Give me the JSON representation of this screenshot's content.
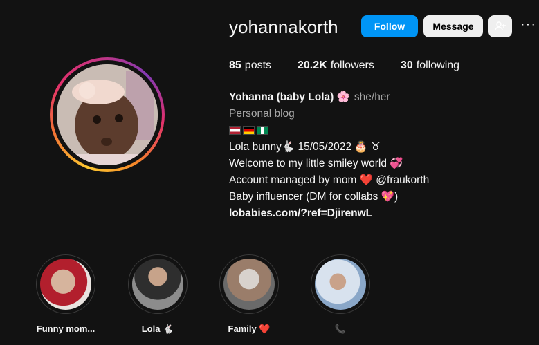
{
  "profile": {
    "username": "yohannakorth",
    "follow_label": "Follow",
    "message_label": "Message",
    "more_icon": "···"
  },
  "stats": {
    "posts_count": "85",
    "posts_label": "posts",
    "followers_count": "20.2K",
    "followers_label": "followers",
    "following_count": "30",
    "following_label": "following"
  },
  "bio": {
    "name": "Yohanna (baby Lola) 🌸",
    "pronouns": "she/her",
    "category": "Personal blog",
    "line1": "Lola bunny🐇 15/05/2022 🎂 ♉",
    "line2": "Welcome to my little smiley world 💞",
    "line3": "Account managed by mom ❤️ @fraukorth",
    "line4": "Baby influencer (DM for collabs 💖)",
    "link": "lobabies.com/?ref=DjirenwL"
  },
  "highlights": [
    {
      "label": "Funny mom...",
      "color_a": "#c9a58f",
      "color_b": "#b21f2d"
    },
    {
      "label": "Lola 🐇",
      "color_a": "#b8a89e",
      "color_b": "#3a3a3a"
    },
    {
      "label": "Family ❤️",
      "color_a": "#9c8a7e",
      "color_b": "#d9d4cf"
    },
    {
      "label": "📞",
      "color_a": "#d8e2ee",
      "color_b": "#8aa7c8"
    }
  ]
}
